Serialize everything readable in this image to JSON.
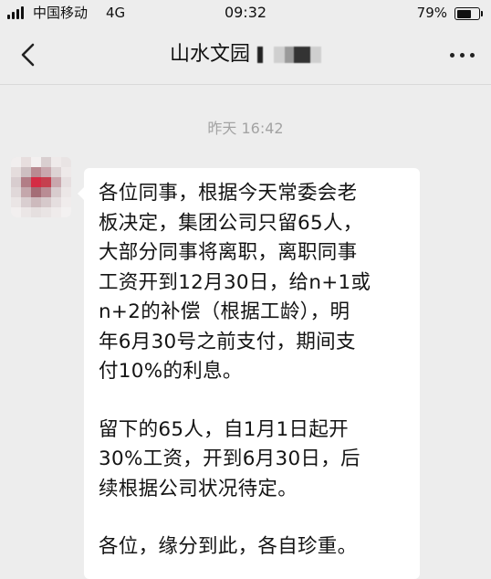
{
  "status_bar": {
    "carrier": "中国移动",
    "network": "4G",
    "time": "09:32",
    "battery_text": "79%",
    "battery_level": 0.79
  },
  "nav": {
    "title": "山水文园"
  },
  "chat": {
    "timestamp": "昨天 16:42",
    "message": {
      "paragraphs": [
        "各位同事，根据今天常委会老\n板决定，集团公司只留65人，\n大部分同事将离职，离职同事\n工资开到12月30日，给n+1或\nn+2的补偿（根据工龄），明\n年6月30号之前支付，期间支\n付10%的利息。",
        "留下的65人，自1月1日起开\n30%工资，开到6月30日，后\n续根据公司状况待定。",
        "各位，缘分到此，各自珍重。"
      ]
    }
  },
  "icons": {
    "signal": "signal-bars-icon",
    "battery": "battery-icon",
    "back": "chevron-left-icon",
    "more": "more-dots-icon"
  },
  "colors": {
    "background": "#ededed",
    "bubble": "#ffffff",
    "timestamp": "#a3a3a3",
    "text": "#141414"
  }
}
